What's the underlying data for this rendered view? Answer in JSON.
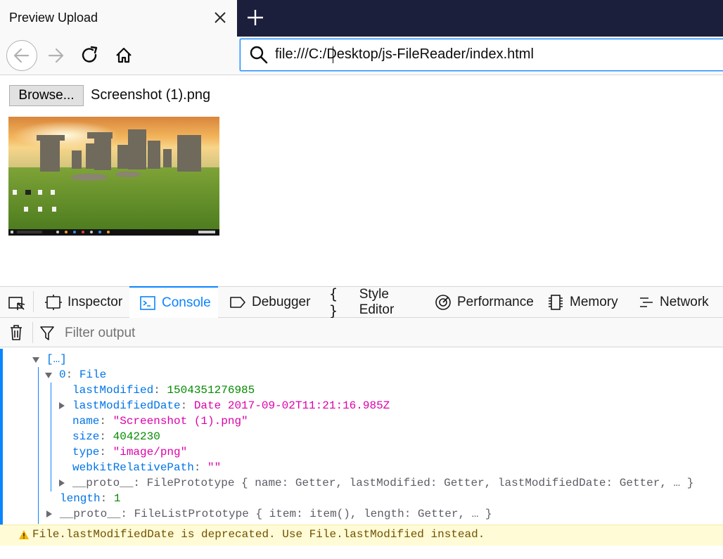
{
  "browser": {
    "tab_title": "Preview Upload",
    "url": "file:///C:/Desktop/js-FileReader/index.html"
  },
  "page": {
    "browse_label": "Browse...",
    "file_name": "Screenshot (1).png"
  },
  "devtools": {
    "tabs": [
      {
        "label": "Inspector",
        "icon": "inspector-icon"
      },
      {
        "label": "Console",
        "icon": "console-icon",
        "selected": true
      },
      {
        "label": "Debugger",
        "icon": "debugger-icon"
      },
      {
        "label": "Style Editor",
        "icon": "braces-icon"
      },
      {
        "label": "Performance",
        "icon": "performance-icon"
      },
      {
        "label": "Memory",
        "icon": "memory-icon"
      },
      {
        "label": "Network",
        "icon": "network-icon"
      }
    ],
    "filter_placeholder": "Filter output",
    "accent_color": "#0a84ff"
  },
  "console": {
    "array_label": "[…]",
    "item_key": "0",
    "item_type": "File",
    "props": [
      {
        "key": "lastModified",
        "value": "1504351276985",
        "kind": "number"
      },
      {
        "key": "lastModifiedDate",
        "value": "Date 2017-09-02T11:21:16.985Z",
        "kind": "date"
      },
      {
        "key": "name",
        "value": "\"Screenshot (1).png\"",
        "kind": "string"
      },
      {
        "key": "size",
        "value": "4042230",
        "kind": "number"
      },
      {
        "key": "type",
        "value": "\"image/png\"",
        "kind": "string"
      },
      {
        "key": "webkitRelativePath",
        "value": "\"\"",
        "kind": "string"
      }
    ],
    "file_proto_key": "__proto__",
    "file_proto_value": "FilePrototype { name: Getter, lastModified: Getter, lastModifiedDate: Getter, … }",
    "length_key": "length",
    "length_value": "1",
    "list_proto_key": "__proto__",
    "list_proto_value": "FileListPrototype { item: item(), length: Getter, … }",
    "warning": "File.lastModifiedDate is deprecated. Use File.lastModified instead."
  }
}
